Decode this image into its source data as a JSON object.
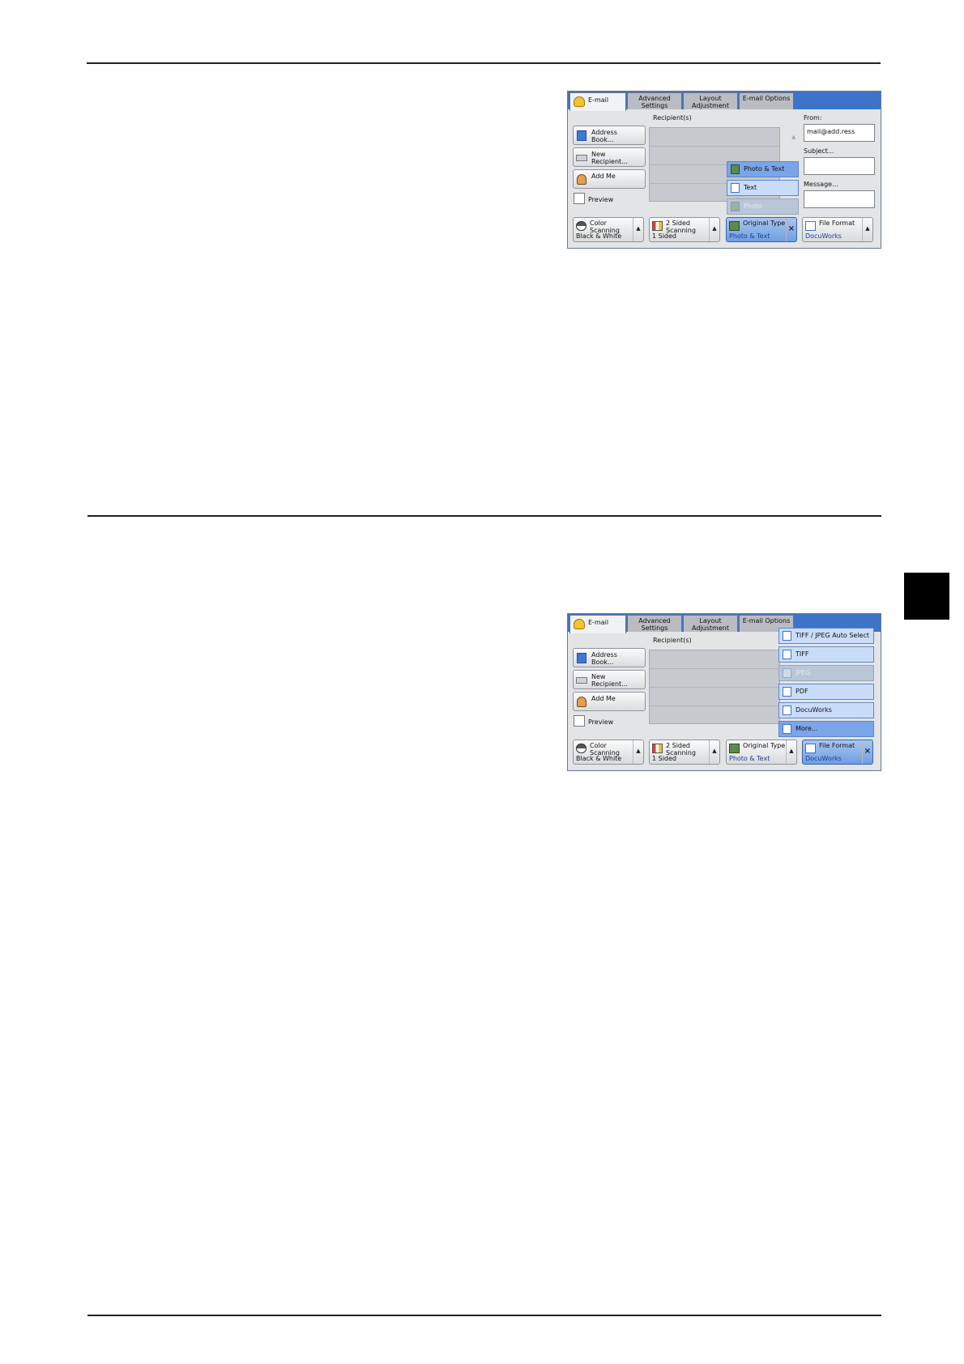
{
  "panel1": {
    "tabs": [
      "E-mail",
      "Advanced Settings",
      "Layout Adjustment",
      "E-mail Options"
    ],
    "recipients_label": "Recipient(s)",
    "left_buttons": [
      "Address Book...",
      "New Recipient...",
      "Add Me"
    ],
    "preview_label": "Preview",
    "from_label": "From:",
    "from_value": "mail@add.ress",
    "subject_label": "Subject...",
    "message_label": "Message...",
    "dropdown": [
      "Photo & Text",
      "Text",
      "Photo"
    ],
    "bottom": [
      {
        "title": "Color Scanning",
        "value": "Black & White"
      },
      {
        "title": "2 Sided Scanning",
        "value": "1 Sided"
      },
      {
        "title": "Original Type",
        "value": "Photo & Text"
      },
      {
        "title": "File Format",
        "value": "DocuWorks"
      }
    ]
  },
  "panel2": {
    "tabs": [
      "E-mail",
      "Advanced Settings",
      "Layout Adjustment",
      "E-mail Options"
    ],
    "recipients_label": "Recipient(s)",
    "left_buttons": [
      "Address Book...",
      "New Recipient...",
      "Add Me"
    ],
    "preview_label": "Preview",
    "dropdown": [
      "TIFF / JPEG Auto Select",
      "TIFF",
      "JPEG",
      "PDF",
      "DocuWorks",
      "More..."
    ],
    "bottom": [
      {
        "title": "Color Scanning",
        "value": "Black & White"
      },
      {
        "title": "2 Sided Scanning",
        "value": "1 Sided"
      },
      {
        "title": "Original Type",
        "value": "Photo & Text"
      },
      {
        "title": "File Format",
        "value": "DocuWorks"
      }
    ]
  }
}
